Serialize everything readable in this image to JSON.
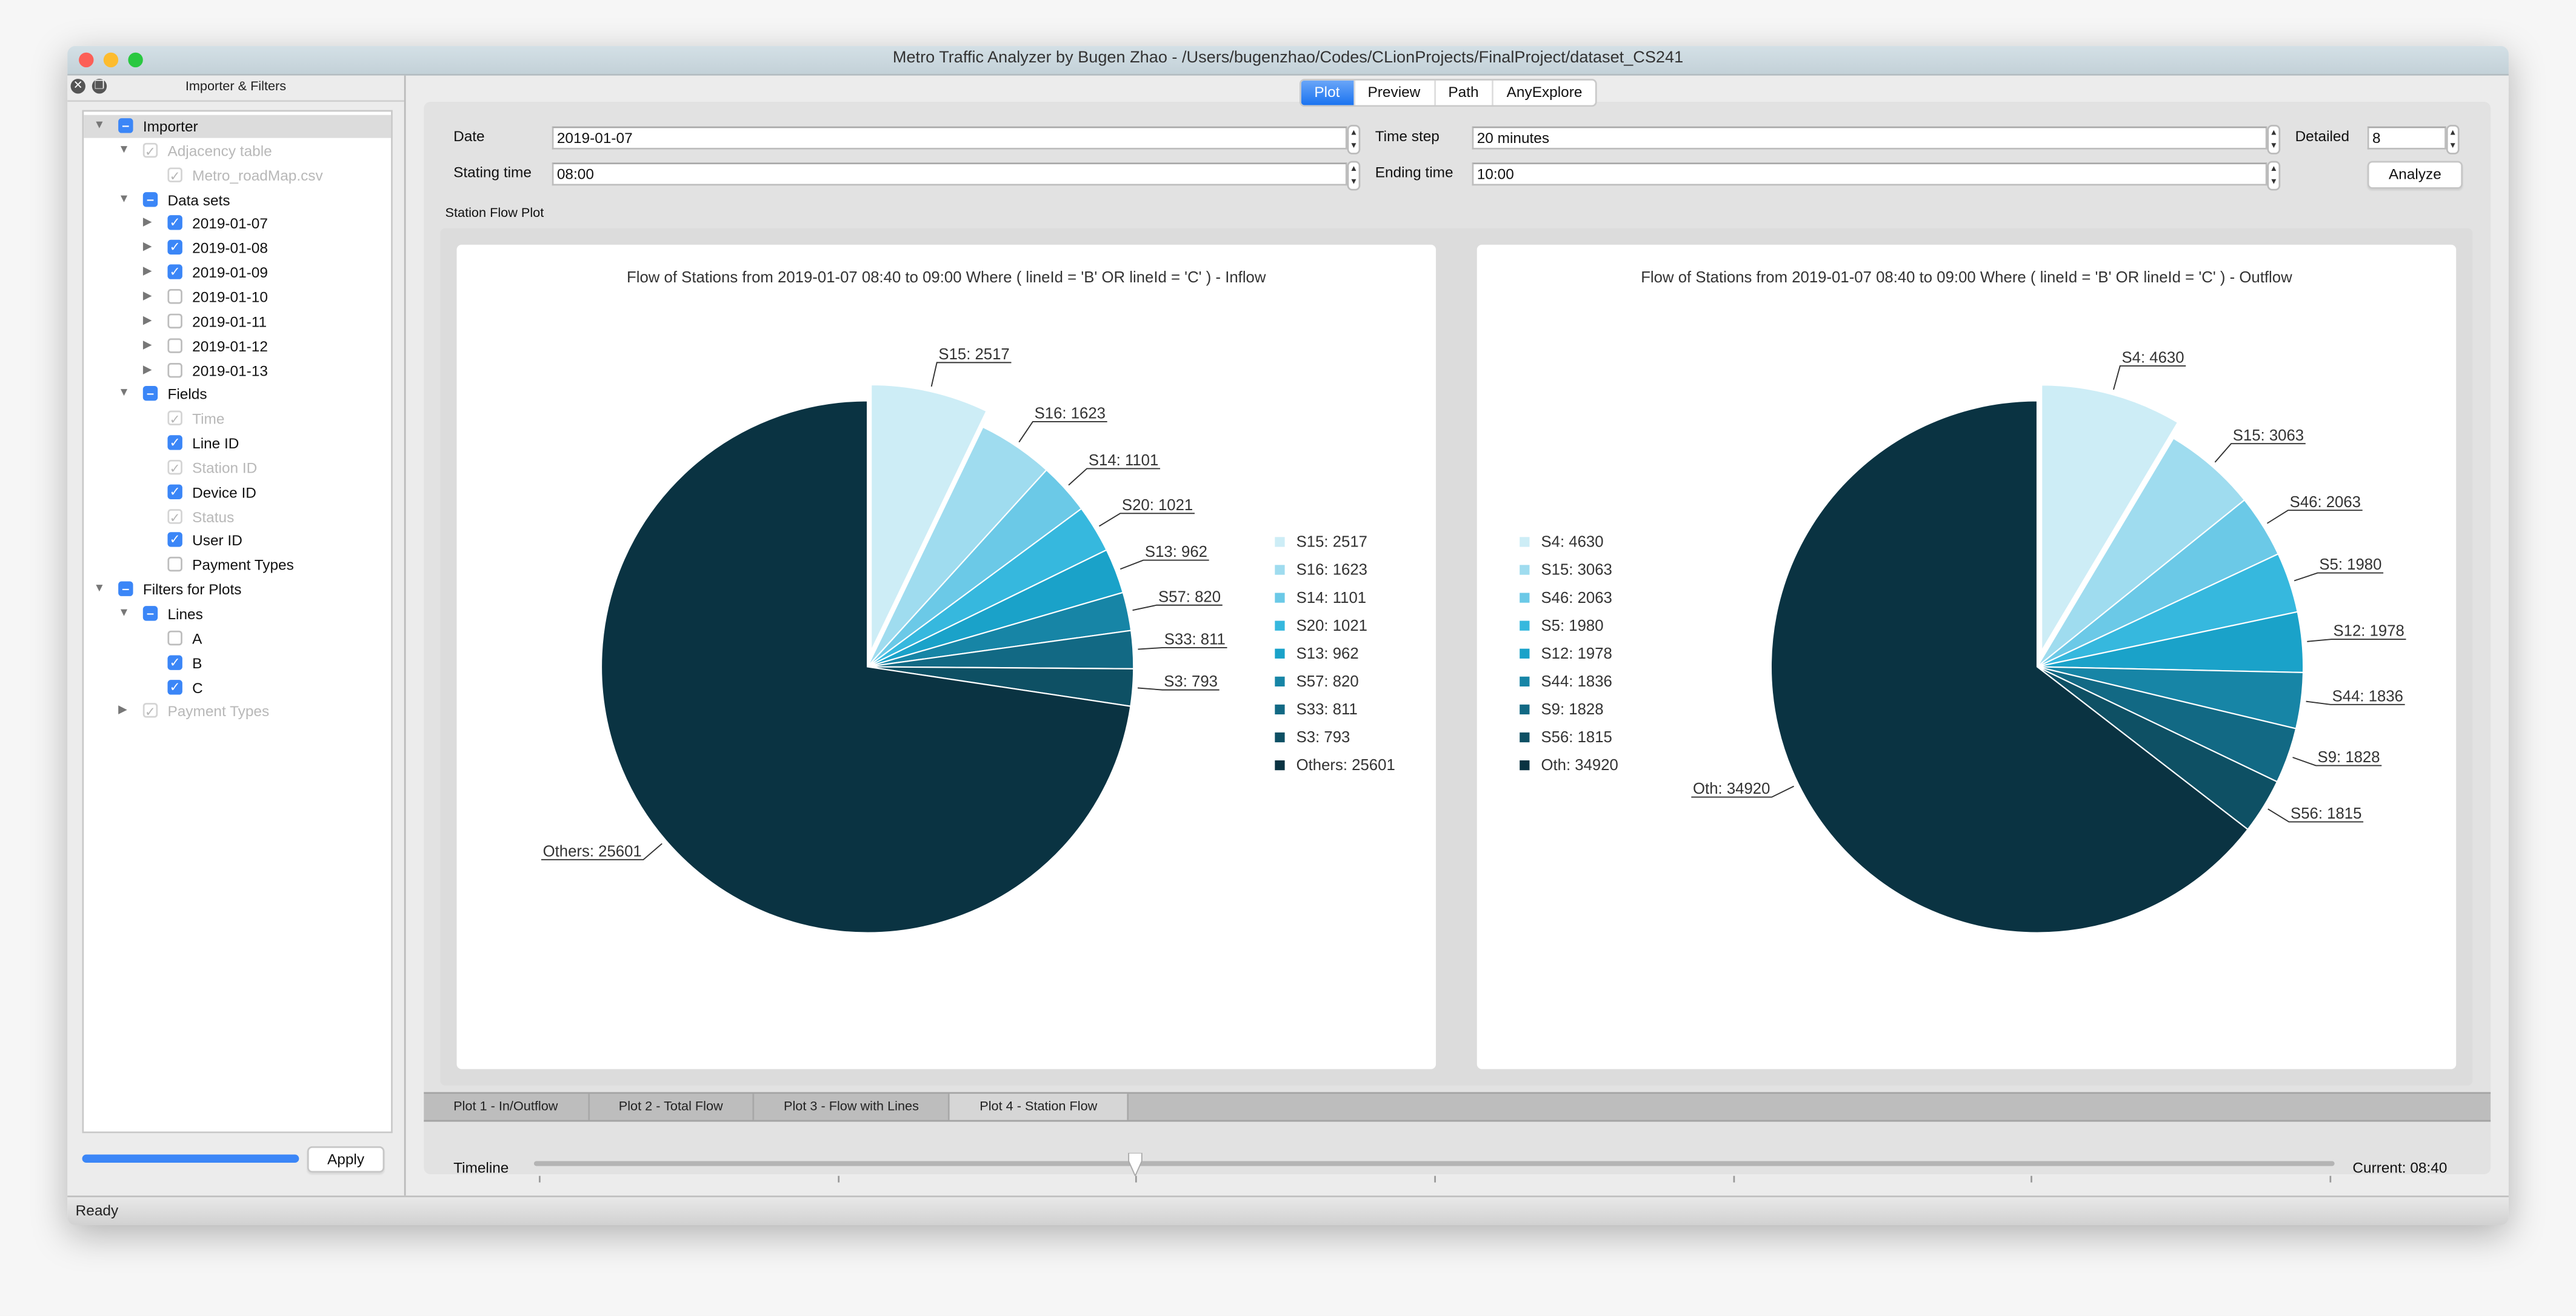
{
  "window": {
    "title": "Metro Traffic Analyzer by Bugen Zhao - /Users/bugenzhao/Codes/CLionProjects/FinalProject/dataset_CS241"
  },
  "dock": {
    "title": "Importer & Filters",
    "tree": [
      {
        "label": "Importer",
        "level": 0,
        "expander": "down",
        "state": "partial",
        "selected": true
      },
      {
        "label": "Adjacency table",
        "level": 1,
        "expander": "down",
        "state": "disabled"
      },
      {
        "label": "Metro_roadMap.csv",
        "level": 2,
        "expander": "none",
        "state": "disabled"
      },
      {
        "label": "Data sets",
        "level": 1,
        "expander": "down",
        "state": "partial"
      },
      {
        "label": "2019-01-07",
        "level": 2,
        "expander": "right",
        "state": "checked"
      },
      {
        "label": "2019-01-08",
        "level": 2,
        "expander": "right",
        "state": "checked"
      },
      {
        "label": "2019-01-09",
        "level": 2,
        "expander": "right",
        "state": "checked"
      },
      {
        "label": "2019-01-10",
        "level": 2,
        "expander": "right",
        "state": "unchecked"
      },
      {
        "label": "2019-01-11",
        "level": 2,
        "expander": "right",
        "state": "unchecked"
      },
      {
        "label": "2019-01-12",
        "level": 2,
        "expander": "right",
        "state": "unchecked"
      },
      {
        "label": "2019-01-13",
        "level": 2,
        "expander": "right",
        "state": "unchecked"
      },
      {
        "label": "Fields",
        "level": 1,
        "expander": "down",
        "state": "partial"
      },
      {
        "label": "Time",
        "level": 2,
        "expander": "none",
        "state": "disabled"
      },
      {
        "label": "Line ID",
        "level": 2,
        "expander": "none",
        "state": "checked"
      },
      {
        "label": "Station ID",
        "level": 2,
        "expander": "none",
        "state": "disabled"
      },
      {
        "label": "Device ID",
        "level": 2,
        "expander": "none",
        "state": "checked"
      },
      {
        "label": "Status",
        "level": 2,
        "expander": "none",
        "state": "disabled"
      },
      {
        "label": "User ID",
        "level": 2,
        "expander": "none",
        "state": "checked"
      },
      {
        "label": "Payment Types",
        "level": 2,
        "expander": "none",
        "state": "unchecked"
      },
      {
        "label": "Filters for Plots",
        "level": 0,
        "expander": "down",
        "state": "partial"
      },
      {
        "label": "Lines",
        "level": 1,
        "expander": "down",
        "state": "partial"
      },
      {
        "label": "A",
        "level": 2,
        "expander": "none",
        "state": "unchecked"
      },
      {
        "label": "B",
        "level": 2,
        "expander": "none",
        "state": "checked"
      },
      {
        "label": "C",
        "level": 2,
        "expander": "none",
        "state": "checked"
      },
      {
        "label": "Payment Types",
        "level": 1,
        "expander": "right",
        "state": "disabled"
      }
    ],
    "progress_percent": 100,
    "apply_label": "Apply"
  },
  "tabs": [
    {
      "label": "Plot",
      "active": true
    },
    {
      "label": "Preview",
      "active": false
    },
    {
      "label": "Path",
      "active": false
    },
    {
      "label": "AnyExplore",
      "active": false
    }
  ],
  "form": {
    "date_label": "Date",
    "date_value": "2019-01-07",
    "start_label": "Stating time",
    "start_value": "08:00",
    "step_label": "Time step",
    "step_value": "20 minutes",
    "end_label": "Ending time",
    "end_value": "10:00",
    "detailed_label": "Detailed",
    "detailed_value": "8",
    "analyze_label": "Analyze"
  },
  "plot_group_title": "Station Flow Plot",
  "colors": [
    "#cdedf6",
    "#9fdcef",
    "#6bc9e7",
    "#36b8de",
    "#1aa2c9",
    "#1785a6",
    "#126984",
    "#0e5064",
    "#0a3342"
  ],
  "chart_data": [
    {
      "type": "pie",
      "title": "Flow of Stations from 2019-01-07 08:40 to 09:00 Where ( lineId = 'B' OR lineId = 'C' ) - Inflow",
      "labels": [
        "S15: 2517",
        "S16: 1623",
        "S14: 1101",
        "S20: 1021",
        "S13: 962",
        "S57: 820",
        "S33: 811",
        "S3: 793",
        "Others: 25601"
      ],
      "categories": [
        "S15",
        "S16",
        "S14",
        "S20",
        "S13",
        "S57",
        "S33",
        "S3",
        "Others"
      ],
      "values": [
        2517,
        1623,
        1101,
        1021,
        962,
        820,
        811,
        793,
        25601
      ],
      "exploded": "S15",
      "legend": "right"
    },
    {
      "type": "pie",
      "title": "Flow of Stations from 2019-01-07 08:40 to 09:00 Where ( lineId = 'B' OR lineId = 'C' ) - Outflow",
      "labels": [
        "S4: 4630",
        "S15: 3063",
        "S46: 2063",
        "S5: 1980",
        "S12: 1978",
        "S44: 1836",
        "S9: 1828",
        "S56: 1815",
        "Oth: 34920"
      ],
      "categories": [
        "S4",
        "S15",
        "S46",
        "S5",
        "S12",
        "S44",
        "S9",
        "S56",
        "Oth"
      ],
      "values": [
        4630,
        3063,
        2063,
        1980,
        1978,
        1836,
        1828,
        1815,
        34920
      ],
      "exploded": "S4",
      "legend": "left"
    }
  ],
  "timeline": {
    "label": "Timeline",
    "position": 2,
    "max": 6,
    "current_text": "Current: 08:40"
  },
  "plot_tabs": [
    {
      "label": "Plot 1 - In/Outflow",
      "active": false
    },
    {
      "label": "Plot 2 - Total Flow",
      "active": false
    },
    {
      "label": "Plot 3 - Flow with Lines",
      "active": false
    },
    {
      "label": "Plot 4 - Station Flow",
      "active": true
    }
  ],
  "status": "Ready"
}
